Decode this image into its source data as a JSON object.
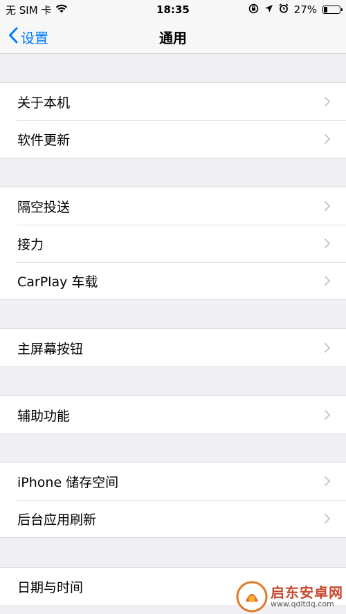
{
  "status_bar": {
    "carrier": "无 SIM 卡",
    "time": "18:35",
    "battery_percent": "27%",
    "battery_level": 0.27
  },
  "nav": {
    "back_label": "设置",
    "title": "通用"
  },
  "groups": [
    {
      "items": [
        "关于本机",
        "软件更新"
      ]
    },
    {
      "items": [
        "隔空投送",
        "接力",
        "CarPlay 车载"
      ]
    },
    {
      "items": [
        "主屏幕按钮"
      ]
    },
    {
      "items": [
        "辅助功能"
      ]
    },
    {
      "items": [
        "iPhone 储存空间",
        "后台应用刷新"
      ]
    },
    {
      "items": [
        "日期与时间"
      ]
    }
  ],
  "watermark": {
    "title": "启东安卓网",
    "url": "www.qdltdq.com"
  },
  "colors": {
    "accent": "#007aff",
    "background": "#efeff4",
    "chevron": "#c7c7cc"
  }
}
